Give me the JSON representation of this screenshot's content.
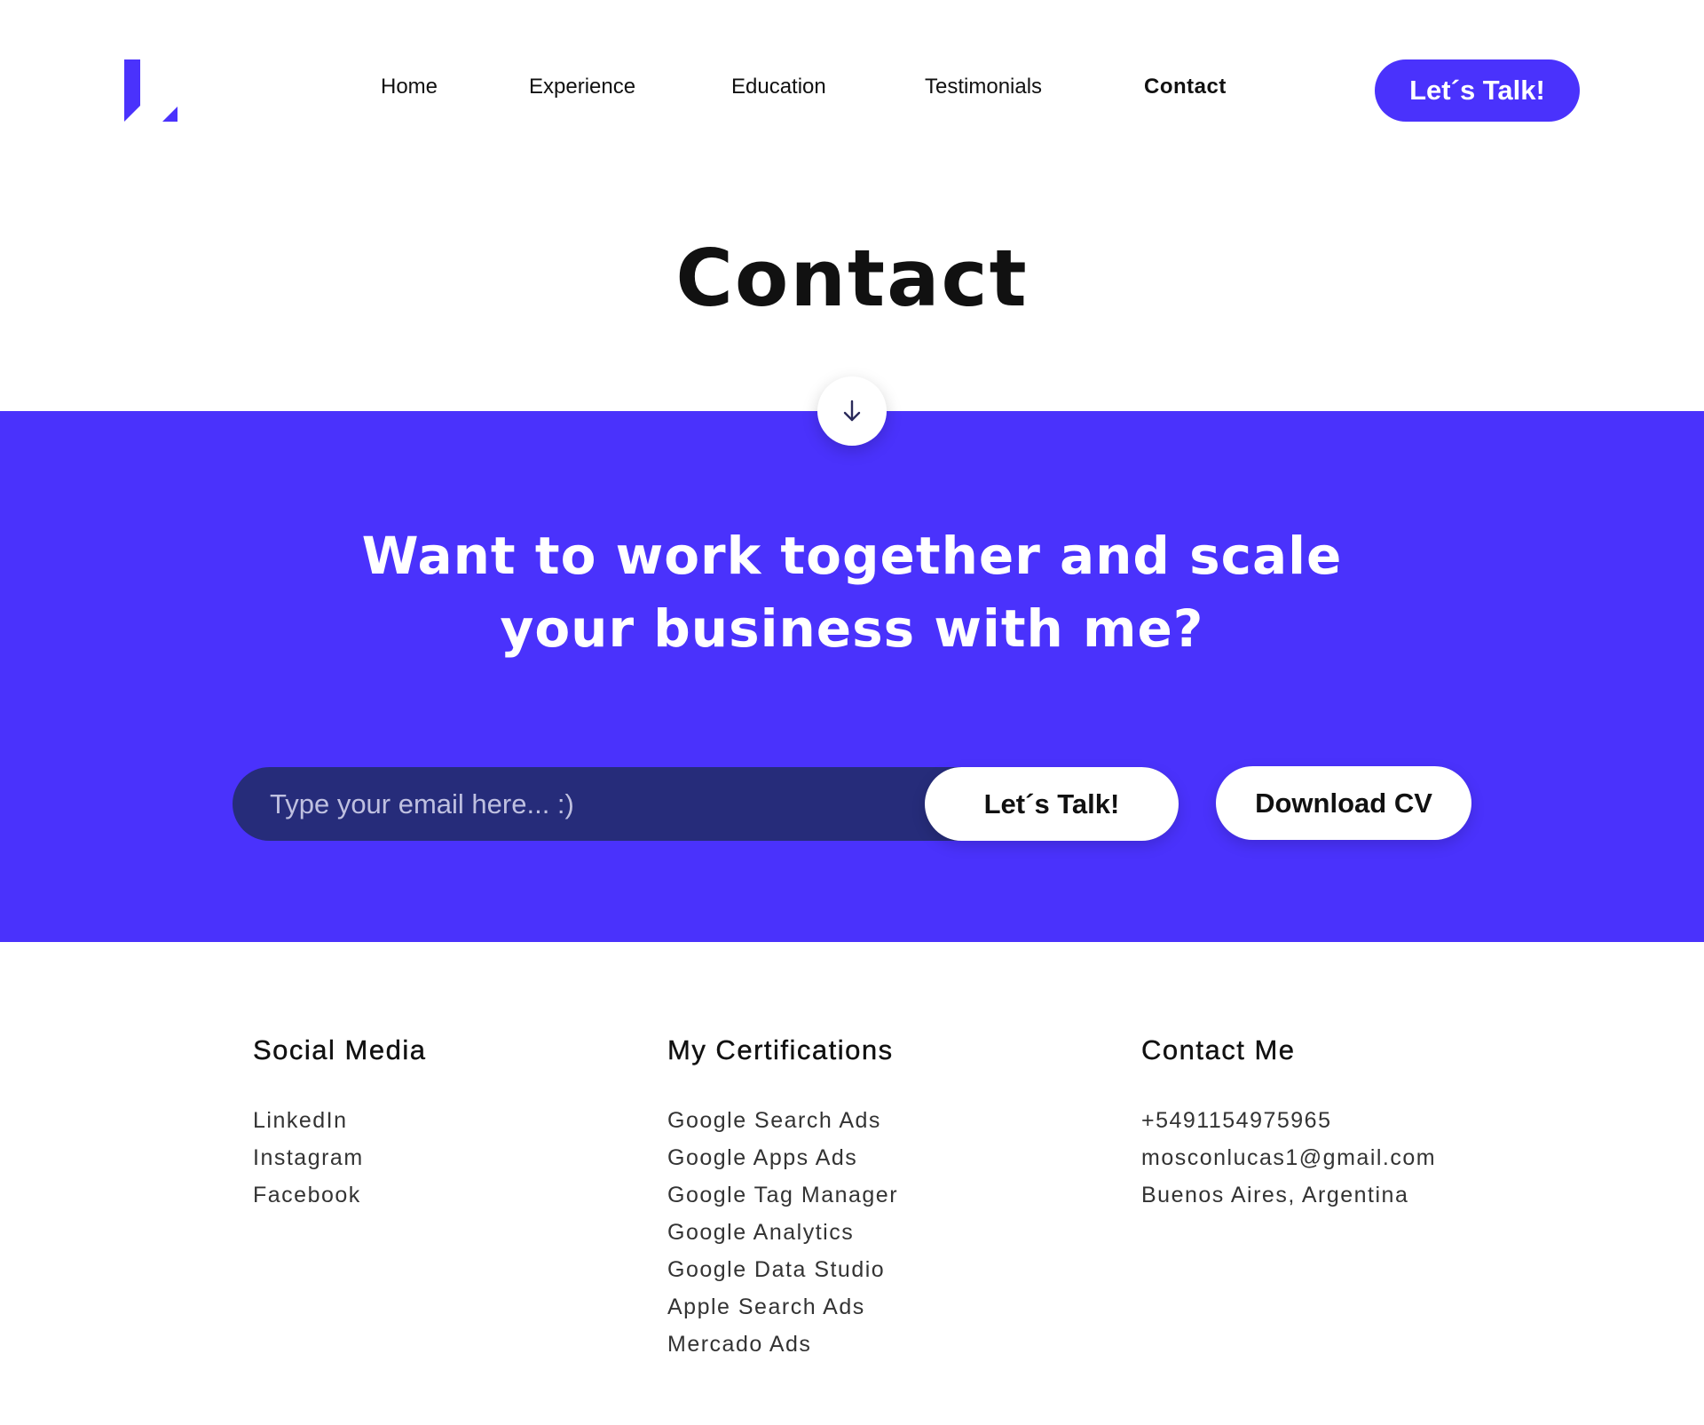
{
  "brand": {
    "accent": "#4a32fc",
    "dark_field": "#262c7a"
  },
  "header": {
    "nav": [
      {
        "label": "Home",
        "active": false
      },
      {
        "label": "Experience",
        "active": false
      },
      {
        "label": "Education",
        "active": false
      },
      {
        "label": "Testimonials",
        "active": false
      },
      {
        "label": "Contact",
        "active": true
      }
    ],
    "cta_label": "Let´s Talk!"
  },
  "main": {
    "title": "Contact",
    "scroll_icon": "arrow-down-icon",
    "headline_line1": "Want to work together and scale",
    "headline_line2": "your business with me?",
    "email_placeholder": "Type your email here... :)",
    "email_value": "",
    "submit_label": "Let´s Talk!",
    "download_label": "Download CV"
  },
  "footer": {
    "social": {
      "title": "Social Media",
      "items": [
        "LinkedIn",
        "Instagram",
        "Facebook"
      ]
    },
    "certifications": {
      "title": "My Certifications",
      "items": [
        "Google Search Ads",
        "Google Apps Ads",
        "Google Tag Manager",
        "Google Analytics",
        "Google Data Studio",
        "Apple Search Ads",
        "Mercado Ads"
      ]
    },
    "contact": {
      "title": "Contact Me",
      "items": [
        "+5491154975965",
        "mosconlucas1@gmail.com",
        "Buenos Aires, Argentina"
      ]
    }
  }
}
